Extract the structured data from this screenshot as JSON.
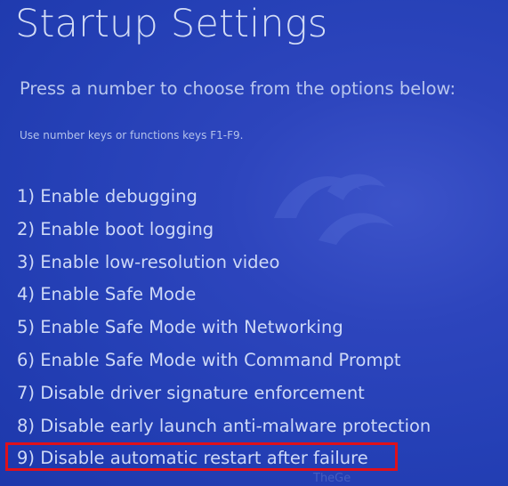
{
  "screen": {
    "title": "Startup Settings",
    "subtitle": "Press a number to choose from the options below:",
    "hint": "Use number keys or functions keys F1-F9.",
    "options": [
      {
        "label": "1) Enable debugging"
      },
      {
        "label": "2) Enable boot logging"
      },
      {
        "label": "3) Enable low-resolution video"
      },
      {
        "label": "4) Enable Safe Mode"
      },
      {
        "label": "5) Enable Safe Mode with Networking"
      },
      {
        "label": "6) Enable Safe Mode with Command Prompt"
      },
      {
        "label": "7) Disable driver signature enforcement"
      },
      {
        "label": "8) Disable early launch anti-malware protection"
      },
      {
        "label": "9) Disable automatic restart after failure"
      }
    ],
    "selected_option": 9,
    "watermark": "TheGe"
  },
  "colors": {
    "background": "#2540b6",
    "text": "#ced9f6",
    "highlight_border": "#e0101a"
  },
  "icons": {
    "background_logo": "stylized-swirl-logo-icon"
  }
}
